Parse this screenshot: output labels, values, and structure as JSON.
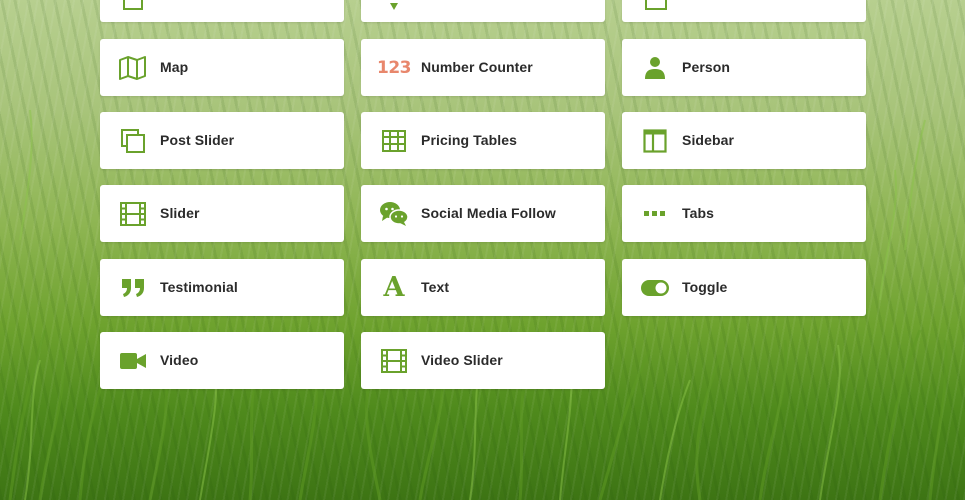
{
  "colors": {
    "accent": "#6aa22c",
    "counter": "#e8876c",
    "text": "#2b2b2b",
    "card": "#ffffff"
  },
  "modules": [
    {
      "label": "Map",
      "icon": "map-icon"
    },
    {
      "label": "Number Counter",
      "icon": "number-counter-icon",
      "icon_text": "123"
    },
    {
      "label": "Person",
      "icon": "person-icon"
    },
    {
      "label": "Post Slider",
      "icon": "post-slider-icon"
    },
    {
      "label": "Pricing Tables",
      "icon": "pricing-table-icon"
    },
    {
      "label": "Sidebar",
      "icon": "sidebar-icon"
    },
    {
      "label": "Slider",
      "icon": "film-icon"
    },
    {
      "label": "Social Media Follow",
      "icon": "chat-bubbles-icon"
    },
    {
      "label": "Tabs",
      "icon": "tabs-dots-icon"
    },
    {
      "label": "Testimonial",
      "icon": "quote-icon"
    },
    {
      "label": "Text",
      "icon": "text-icon",
      "icon_text": "A"
    },
    {
      "label": "Toggle",
      "icon": "toggle-icon"
    },
    {
      "label": "Video",
      "icon": "video-camera-icon"
    },
    {
      "label": "Video  Slider",
      "icon": "film-icon"
    }
  ]
}
